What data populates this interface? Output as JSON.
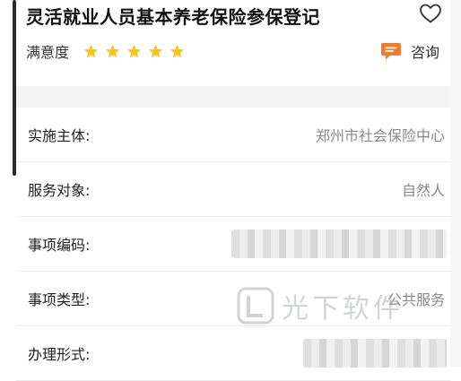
{
  "header": {
    "title": "灵活就业人员基本养老保险参保登记",
    "favorite_icon": "heart-outline-icon",
    "rating_label": "满意度",
    "rating_value": 5,
    "rating_max": 5,
    "star_color": "#f5c518",
    "consult_label": "咨询",
    "consult_icon": "chat-bubble-icon",
    "consult_color": "#f07b2b"
  },
  "details": [
    {
      "label": "实施主体:",
      "value": "郑州市社会保险中心"
    },
    {
      "label": "服务对象:",
      "value": "自然人"
    },
    {
      "label": "事项编码:",
      "value": ""
    },
    {
      "label": "事项类型:",
      "value": "公共服务"
    },
    {
      "label": "办理形式:",
      "value": ""
    }
  ],
  "watermark": {
    "text": "光下软件"
  }
}
